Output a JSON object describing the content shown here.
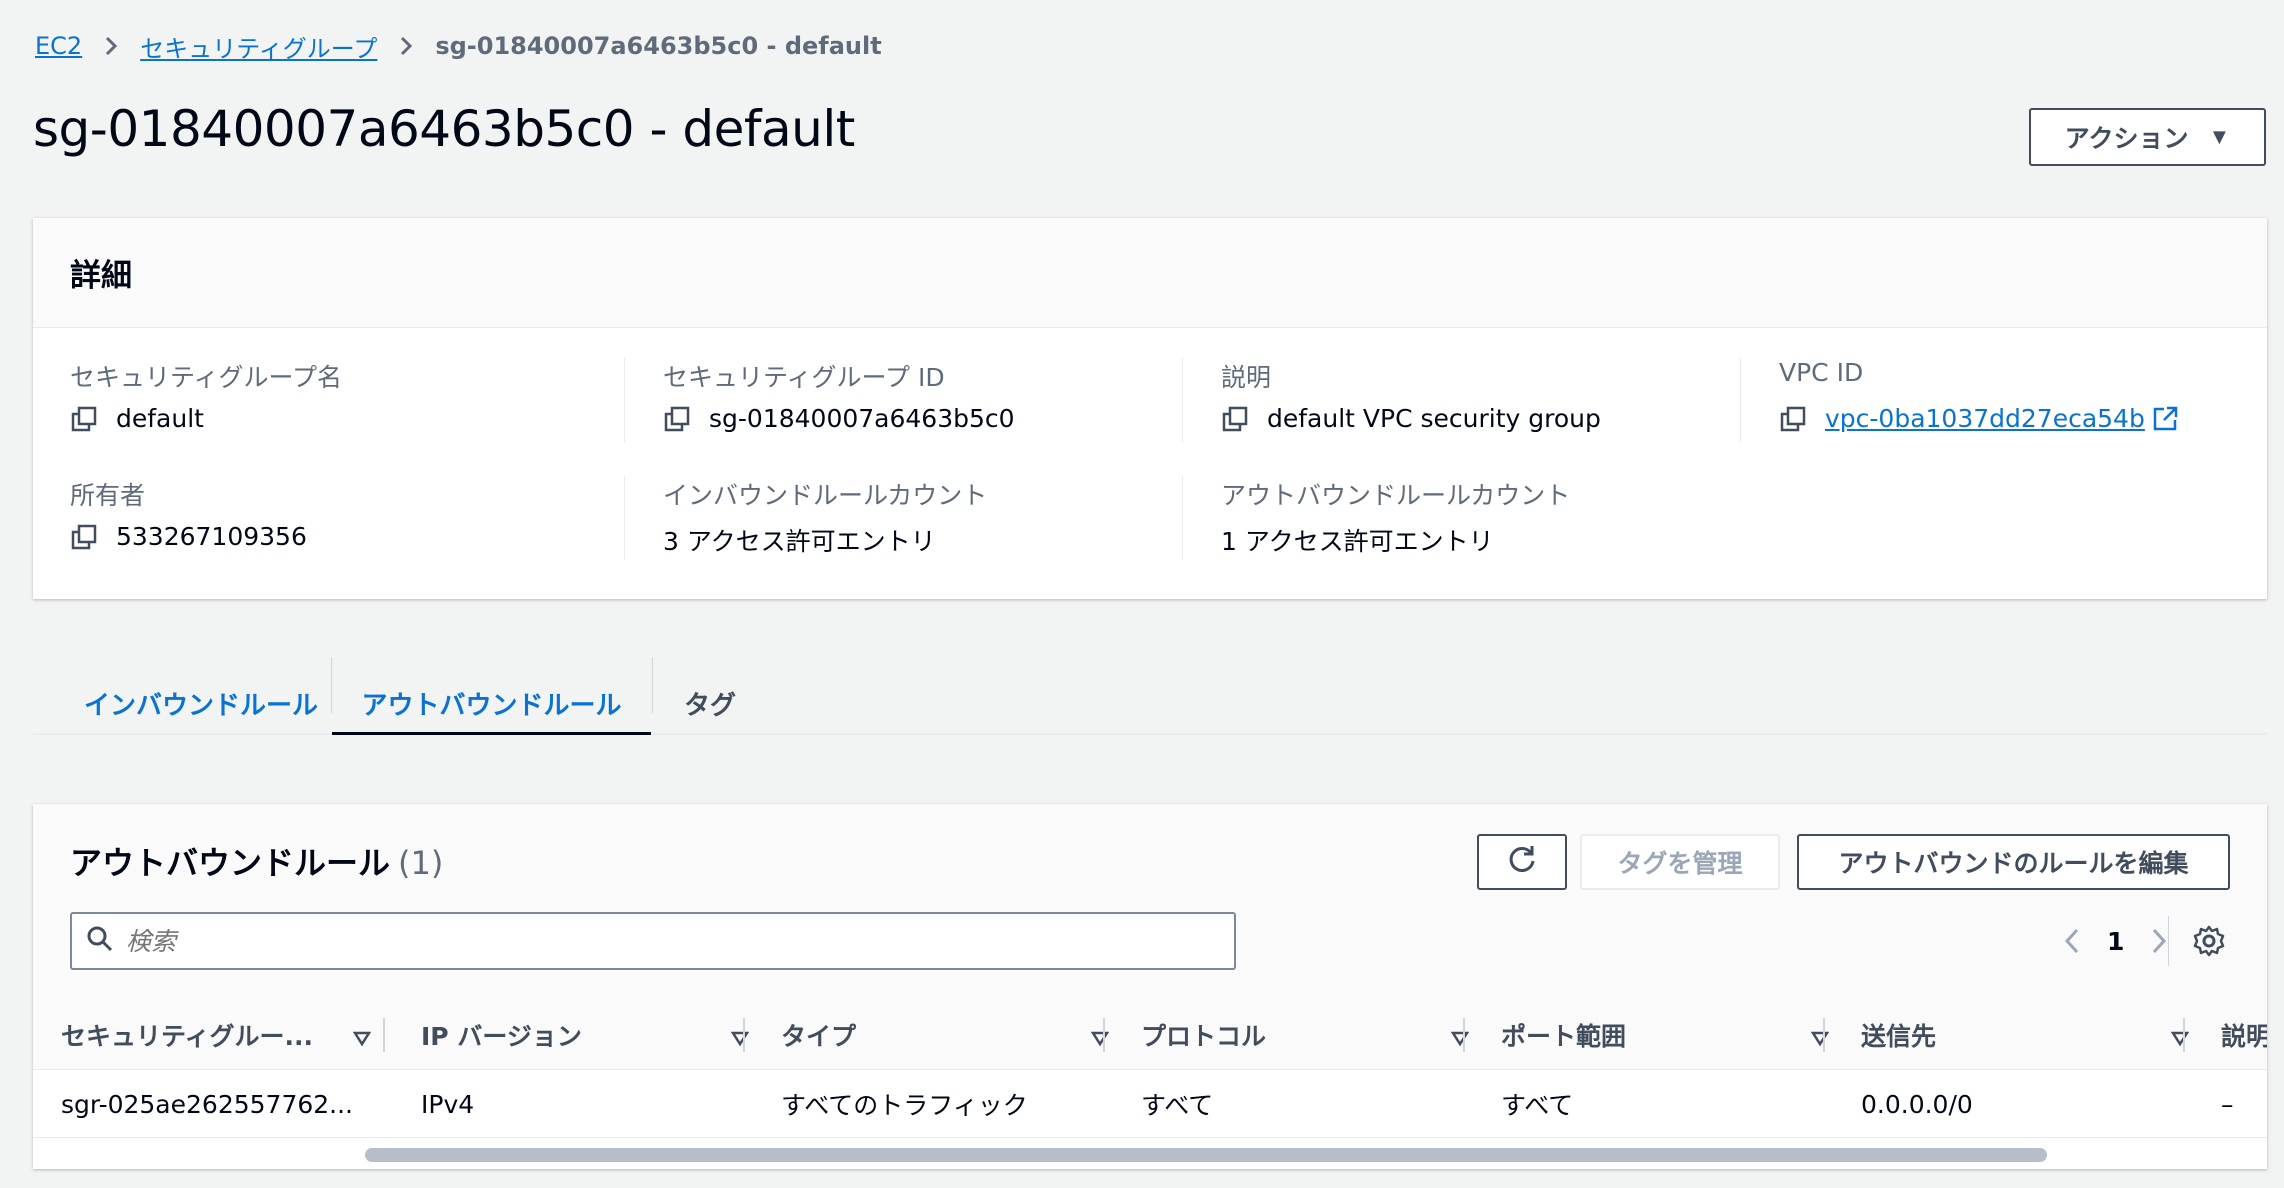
{
  "breadcrumb": {
    "items": [
      "EC2",
      "セキュリティグループ"
    ],
    "current": "sg-01840007a6463b5c0 - default"
  },
  "page": {
    "title": "sg-01840007a6463b5c0 - default",
    "action_label": "アクション",
    "action_caret": "▼"
  },
  "details": {
    "header": "詳細",
    "fields": {
      "sg_name_label": "セキュリティグループ名",
      "sg_name_value": "default",
      "sg_id_label": "セキュリティグループ ID",
      "sg_id_value": "sg-01840007a6463b5c0",
      "desc_label": "説明",
      "desc_value": "default VPC security group",
      "vpc_label": "VPC ID",
      "vpc_value": "vpc-0ba1037dd27eca54b",
      "owner_label": "所有者",
      "owner_value": "533267109356",
      "inbound_count_label": "インバウンドルールカウント",
      "inbound_count_value": "3 アクセス許可エントリ",
      "outbound_count_label": "アウトバウンドルールカウント",
      "outbound_count_value": "1 アクセス許可エントリ"
    }
  },
  "tabs": [
    "インバウンドルール",
    "アウトバウンドルール",
    "タグ"
  ],
  "rules": {
    "title": "アウトバウンドルール",
    "count": "(1)",
    "manage_tags_label": "タグを管理",
    "edit_label": "アウトバウンドのルールを編集",
    "search_placeholder": "検索",
    "page_number": "1",
    "columns": [
      "セキュリティグルー...",
      "IP バージョン",
      "タイプ",
      "プロトコル",
      "ポート範囲",
      "送信先",
      "説明"
    ],
    "rows": [
      [
        "sgr-025ae262557762...",
        "IPv4",
        "すべてのトラフィック",
        "すべて",
        "すべて",
        "0.0.0.0/0",
        "–"
      ]
    ]
  },
  "colors": {
    "link": "#0972d3",
    "text": "#000716",
    "muted": "#5f6b7a",
    "background": "#f2f3f3"
  }
}
